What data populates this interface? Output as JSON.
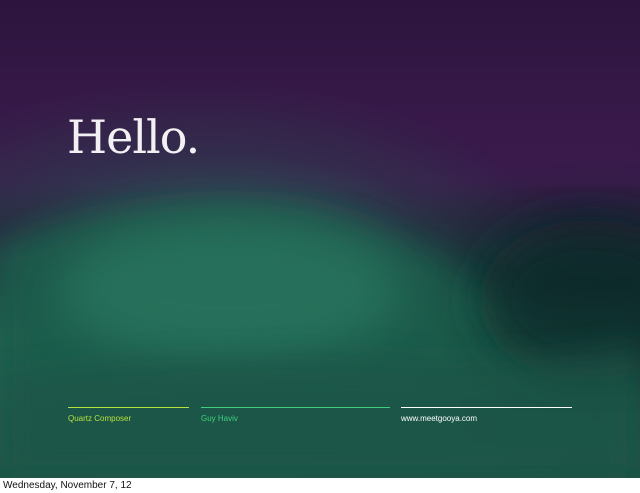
{
  "slide": {
    "title": "Hello.",
    "footer": [
      {
        "label": "Quartz Composer",
        "color": "#b6e23c"
      },
      {
        "label": "Guy Haviv",
        "color": "#3fcf7a"
      },
      {
        "label": "www.meetgooya.com",
        "color": "#ffffff"
      }
    ]
  },
  "caption": "Wednesday, November 7, 12",
  "colors": {
    "purple": "#3a1a4c",
    "green": "#1e5c4d",
    "title_text": "#f3f0f4"
  }
}
